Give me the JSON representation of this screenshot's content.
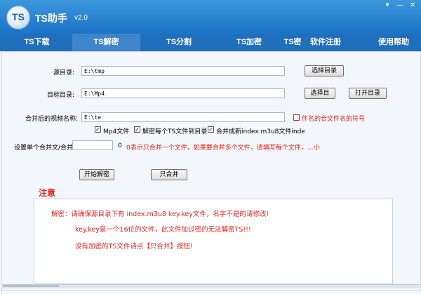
{
  "app": {
    "logo_text": "TS",
    "title": "TS助手",
    "version": "v2.0",
    "window_buttons": {
      "dropdown": "▾",
      "minimize": "—",
      "close": "✕"
    }
  },
  "tabs": [
    {
      "label": "TS下载",
      "active": false
    },
    {
      "label": "TS解密",
      "active": true
    },
    {
      "label": "TS分割",
      "active": false
    },
    {
      "label": "TS加密",
      "active": false
    },
    {
      "label": "TS密",
      "active": false
    },
    {
      "label": "软件注册",
      "active": false
    },
    {
      "label": "使用帮助",
      "active": false
    }
  ],
  "form": {
    "source_dir": {
      "label": "源目录:",
      "value": "E:\\tmp",
      "button": "选择目录"
    },
    "target_dir": {
      "label": "目标目录:",
      "value": "E:\\Mp4",
      "button": "选择目",
      "open_button": "打开目录"
    },
    "merged_name": {
      "label": "合并后的视频名称:",
      "value": "E:\\te",
      "hint": "件名的合文件名的符号"
    },
    "checkboxes": [
      {
        "label": "Mp4文件",
        "checked": true
      },
      {
        "label": "解密每个TS文件到目录",
        "checked": true
      },
      {
        "label": "合并成新index.m3u8文件index...",
        "checked": true
      }
    ],
    "merge_count": {
      "label": "设置单个合并文/合并'",
      "value": "",
      "value2": "0",
      "hint": "0表示只合并一个文件，如果要合并多个文件，请填写每个文件，…小"
    }
  },
  "buttons": {
    "start": "开始解密",
    "merge_only": "只合并"
  },
  "notice": {
    "title": "注意",
    "line1": "解密：请确保源目录下有 index.m3u8  key.key文件，名字不是的请修改!",
    "line2": "key.key是一个16位的文件，此文件加过密的无法解密TS!!!",
    "line3": "没有加密的TS文件请点【只合并】按钮!"
  },
  "colors": {
    "header_top": "#3d97dc",
    "header_bottom": "#1b74c6",
    "tabbar": "#1f6fbd",
    "active_tab": "#3f85cc",
    "warning_red": "#e2231a"
  }
}
